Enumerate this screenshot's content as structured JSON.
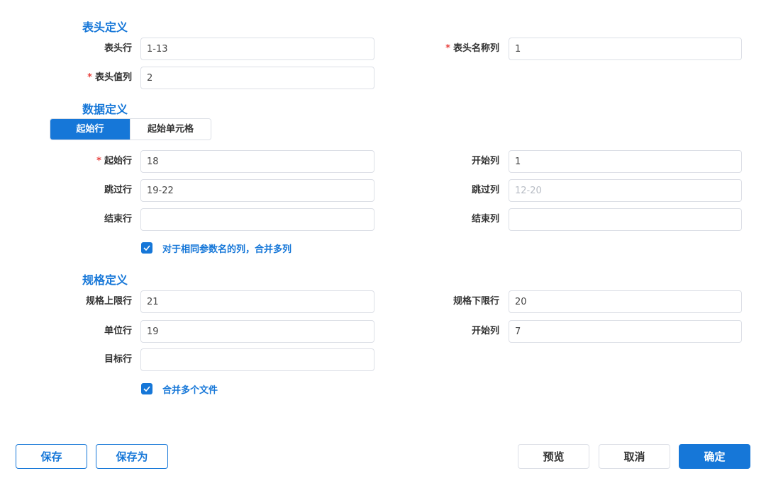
{
  "header_section": {
    "title": "表头定义",
    "header_row_label": "表头行",
    "header_row_value": "1-13",
    "header_name_col_label": "表头名称列",
    "header_name_col_value": "1",
    "header_value_col_label": "表头值列",
    "header_value_col_value": "2",
    "required_mark": "*"
  },
  "data_section": {
    "title": "数据定义",
    "tabs": [
      {
        "label": "起始行",
        "active": true
      },
      {
        "label": "起始单元格",
        "active": false
      }
    ],
    "start_row_label": "起始行",
    "start_row_value": "18",
    "start_col_label": "开始列",
    "start_col_value": "1",
    "skip_row_label": "跳过行",
    "skip_row_value": "19-22",
    "skip_col_label": "跳过列",
    "skip_col_placeholder": "12-20",
    "end_row_label": "结束行",
    "end_row_value": "",
    "end_col_label": "结束列",
    "end_col_value": "",
    "merge_same_param_label": "对于相同参数名的列，合并多列",
    "merge_same_param_checked": true
  },
  "spec_section": {
    "title": "规格定义",
    "upper_limit_row_label": "规格上限行",
    "upper_limit_row_value": "21",
    "lower_limit_row_label": "规格下限行",
    "lower_limit_row_value": "20",
    "unit_row_label": "单位行",
    "unit_row_value": "19",
    "start_col_label": "开始列",
    "start_col_value": "7",
    "target_row_label": "目标行",
    "target_row_value": "",
    "merge_files_label": "合并多个文件",
    "merge_files_checked": true
  },
  "footer": {
    "save_label": "保存",
    "save_as_label": "保存为",
    "preview_label": "预览",
    "cancel_label": "取消",
    "confirm_label": "确定"
  },
  "colors": {
    "accent": "#1677d8",
    "required": "#e8423f",
    "border": "#dcdfe6"
  },
  "icons": {
    "checkbox": "checkmark-icon"
  }
}
